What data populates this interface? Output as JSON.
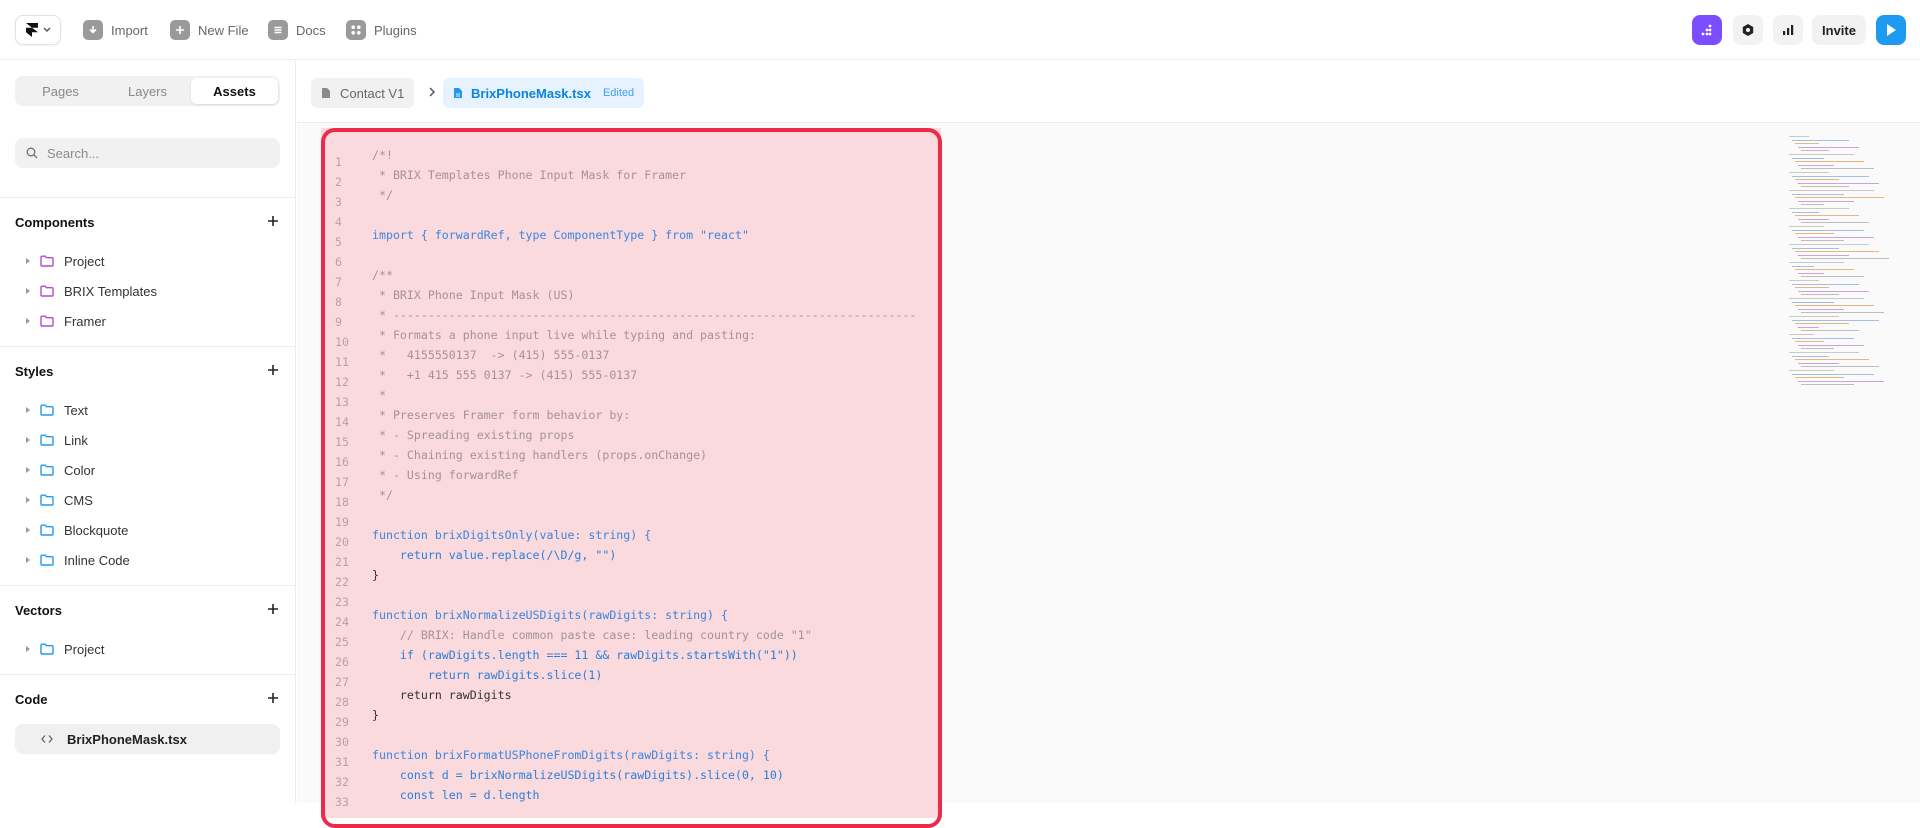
{
  "topbar": {
    "items": [
      {
        "label": "Import",
        "icon": "download-icon"
      },
      {
        "label": "New File",
        "icon": "plus-square-icon"
      },
      {
        "label": "Docs",
        "icon": "docs-icon"
      },
      {
        "label": "Plugins",
        "icon": "plugins-icon"
      }
    ],
    "invite_label": "Invite",
    "colors": {
      "purple": "#7c4dff",
      "play": "#1e9bf0"
    }
  },
  "sidebar": {
    "tabs": [
      "Pages",
      "Layers",
      "Assets"
    ],
    "active_tab": "Assets",
    "search": {
      "placeholder": "Search..."
    },
    "sections": {
      "components": {
        "title": "Components",
        "items": [
          "Project",
          "BRIX Templates",
          "Framer"
        ],
        "folder_color": "#b24ad4"
      },
      "styles": {
        "title": "Styles",
        "items": [
          "Text",
          "Link",
          "Color",
          "CMS",
          "Blockquote",
          "Inline Code"
        ],
        "folder_color": "#1e9bf0"
      },
      "vectors": {
        "title": "Vectors",
        "items": [
          "Project"
        ],
        "folder_color": "#1e9bf0"
      },
      "code": {
        "title": "Code",
        "items": [
          "BrixPhoneMask.tsx"
        ]
      }
    }
  },
  "breadcrumb": {
    "parent": "Contact V1",
    "file": "BrixPhoneMask.tsx",
    "status": "Edited"
  },
  "editor": {
    "lines": [
      {
        "n": "1",
        "t": "/*!"
      },
      {
        "n": "2",
        "t": " * BRIX Templates Phone Input Mask for Framer"
      },
      {
        "n": "3",
        "t": " */"
      },
      {
        "n": "4",
        "t": ""
      },
      {
        "n": "5",
        "t": "import { forwardRef, type ComponentType } from \"react\""
      },
      {
        "n": "6",
        "t": ""
      },
      {
        "n": "7",
        "t": "/**"
      },
      {
        "n": "8",
        "t": " * BRIX Phone Input Mask (US)"
      },
      {
        "n": "9",
        "t": " * ---------------------------------------------------------------------------"
      },
      {
        "n": "10",
        "t": " * Formats a phone input live while typing and pasting:"
      },
      {
        "n": "11",
        "t": " *   4155550137  -> (415) 555-0137"
      },
      {
        "n": "12",
        "t": " *   +1 415 555 0137 -> (415) 555-0137"
      },
      {
        "n": "13",
        "t": " *"
      },
      {
        "n": "14",
        "t": " * Preserves Framer form behavior by:"
      },
      {
        "n": "15",
        "t": " * - Spreading existing props"
      },
      {
        "n": "16",
        "t": " * - Chaining existing handlers (props.onChange)"
      },
      {
        "n": "17",
        "t": " * - Using forwardRef"
      },
      {
        "n": "18",
        "t": " */"
      },
      {
        "n": "19",
        "t": ""
      },
      {
        "n": "20",
        "t": "function brixDigitsOnly(value: string) {"
      },
      {
        "n": "21",
        "t": "    return value.replace(/\\D/g, \"\")"
      },
      {
        "n": "22",
        "t": "}"
      },
      {
        "n": "23",
        "t": ""
      },
      {
        "n": "24",
        "t": "function brixNormalizeUSDigits(rawDigits: string) {"
      },
      {
        "n": "25",
        "t": "    // BRIX: Handle common paste case: leading country code \"1\""
      },
      {
        "n": "26",
        "t": "    if (rawDigits.length === 11 && rawDigits.startsWith(\"1\"))"
      },
      {
        "n": "27",
        "t": "        return rawDigits.slice(1)"
      },
      {
        "n": "28",
        "t": "    return rawDigits"
      },
      {
        "n": "29",
        "t": "}"
      },
      {
        "n": "30",
        "t": ""
      },
      {
        "n": "31",
        "t": "function brixFormatUSPhoneFromDigits(rawDigits: string) {"
      },
      {
        "n": "32",
        "t": "    const d = brixNormalizeUSDigits(rawDigits).slice(0, 10)"
      },
      {
        "n": "33",
        "t": "    const len = d.length"
      }
    ]
  }
}
